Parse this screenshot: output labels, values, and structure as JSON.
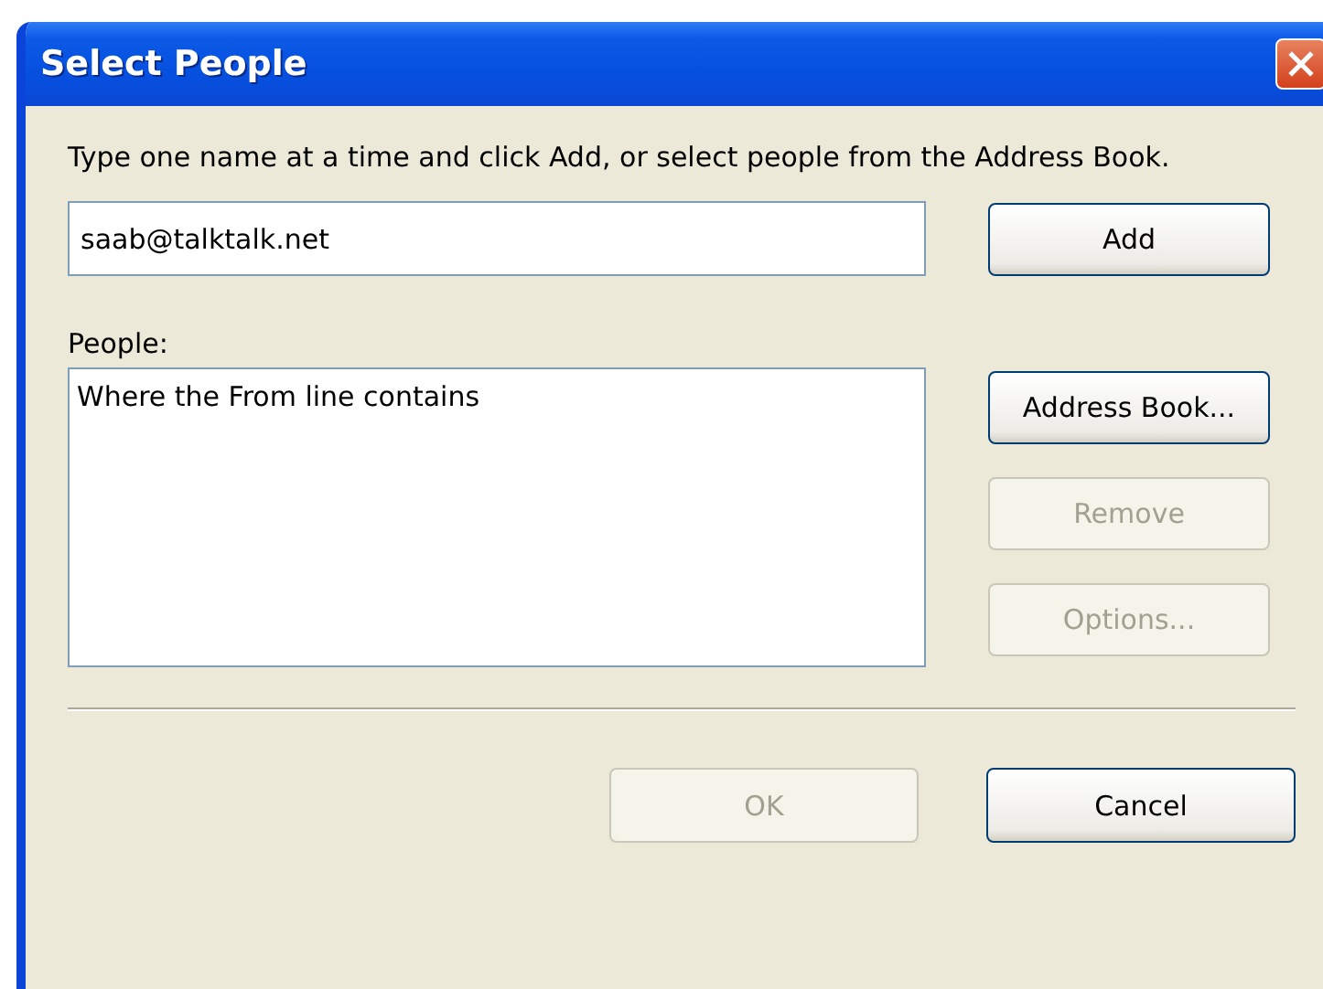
{
  "window": {
    "title": "Select People"
  },
  "instruction": "Type one name at a time and click Add, or select people from the Address Book.",
  "name_field": {
    "value": "saab@talktalk.net"
  },
  "add_button": {
    "label": "Add",
    "disabled": false
  },
  "people": {
    "label": "People:",
    "items": [
      "Where the From line contains"
    ]
  },
  "side_buttons": [
    {
      "label": "Address Book...",
      "disabled": false
    },
    {
      "label": "Remove",
      "disabled": true
    },
    {
      "label": "Options...",
      "disabled": true
    }
  ],
  "footer_buttons": [
    {
      "label": "OK",
      "disabled": true
    },
    {
      "label": "Cancel",
      "disabled": false
    }
  ]
}
